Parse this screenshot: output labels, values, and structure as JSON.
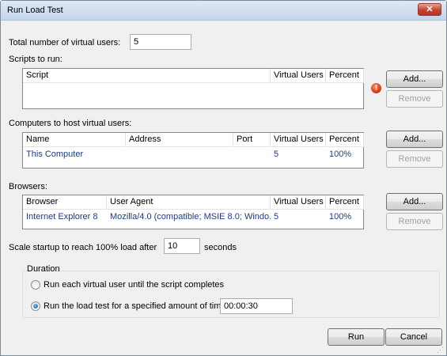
{
  "window": {
    "title": "Run Load Test",
    "close_glyph": "✕"
  },
  "total_users": {
    "label": "Total number of virtual users:",
    "value": "5"
  },
  "scripts": {
    "label": "Scripts to run:",
    "columns": [
      "Script",
      "Virtual Users",
      "Percent"
    ],
    "rows": [],
    "add_label": "Add...",
    "remove_label": "Remove",
    "error_glyph": "!"
  },
  "computers": {
    "label": "Computers to host virtual users:",
    "columns": [
      "Name",
      "Address",
      "Port",
      "Virtual Users",
      "Percent"
    ],
    "rows": [
      {
        "name": "This Computer",
        "address": "",
        "port": "",
        "virtual_users": "5",
        "percent": "100%"
      }
    ],
    "add_label": "Add...",
    "remove_label": "Remove"
  },
  "browsers": {
    "label": "Browsers:",
    "columns": [
      "Browser",
      "User Agent",
      "Virtual Users",
      "Percent"
    ],
    "rows": [
      {
        "browser": "Internet Explorer 8",
        "user_agent": "Mozilla/4.0 (compatible; MSIE 8.0; Windo...",
        "virtual_users": "5",
        "percent": "100%"
      }
    ],
    "add_label": "Add...",
    "remove_label": "Remove"
  },
  "scale": {
    "label_before": "Scale startup to reach 100% load after",
    "value": "10",
    "label_after": "seconds"
  },
  "duration": {
    "legend": "Duration",
    "option1": "Run each virtual user until the script completes",
    "option2": "Run the load test for a specified amount of time:",
    "time_value": "00:00:30",
    "selected": "option2"
  },
  "footer": {
    "run_label": "Run",
    "cancel_label": "Cancel"
  },
  "colors": {
    "accent": "#1a3a8c",
    "close": "#c4432f",
    "error": "#d52f0c"
  }
}
